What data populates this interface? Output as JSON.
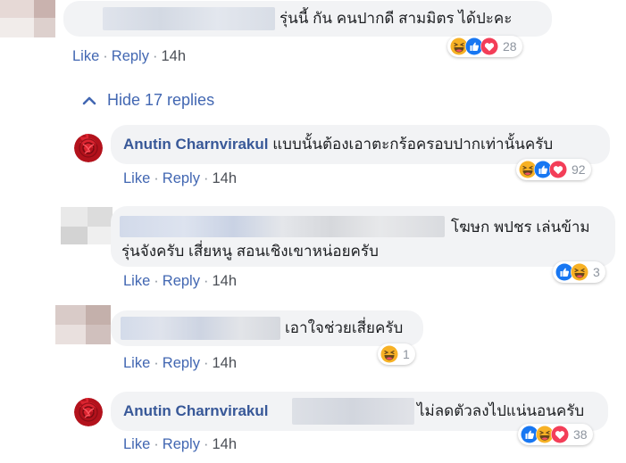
{
  "comments": [
    {
      "text": "รุ่นนี้ กัน คนปากดี สามมิตร ได้ปะคะ",
      "actions": {
        "like": "Like",
        "reply": "Reply",
        "time": "14h"
      },
      "reactions": {
        "icons": [
          "haha-icon",
          "like-icon",
          "love-icon"
        ],
        "count": "28"
      }
    }
  ],
  "hide_replies": {
    "label": "Hide 17 replies"
  },
  "replies": [
    {
      "author": "Anutin Charnvirakul",
      "text": "แบบนั้นต้องเอาตะกร้อครอบปากเท่านั้นครับ",
      "actions": {
        "like": "Like",
        "reply": "Reply",
        "time": "14h"
      },
      "reactions": {
        "icons": [
          "haha-icon",
          "like-icon",
          "love-icon"
        ],
        "count": "92"
      }
    },
    {
      "text_line1": "โฆษก พปชร เล่นข้าม",
      "text_line2": "รุ่นจังครับ เสี่ยหนู สอนเชิงเขาหน่อยครับ",
      "actions": {
        "like": "Like",
        "reply": "Reply",
        "time": "14h"
      },
      "reactions": {
        "icons": [
          "like-icon",
          "haha-icon"
        ],
        "count": "3"
      }
    },
    {
      "text": "เอาใจช่วยเสี่ยครับ",
      "actions": {
        "like": "Like",
        "reply": "Reply",
        "time": "14h"
      },
      "reactions": {
        "icons": [
          "haha-icon"
        ],
        "count": "1"
      }
    },
    {
      "author": "Anutin Charnvirakul",
      "text": "ไม่ลดตัวลงไปแน่นอนครับ",
      "actions": {
        "like": "Like",
        "reply": "Reply",
        "time": "14h"
      },
      "reactions": {
        "icons": [
          "like-icon",
          "haha-icon",
          "love-icon"
        ],
        "count": "38"
      }
    }
  ],
  "colors": {
    "link": "#4267b2",
    "author": "#385898",
    "bubble": "#f2f3f5",
    "meta": "#8d949e"
  }
}
